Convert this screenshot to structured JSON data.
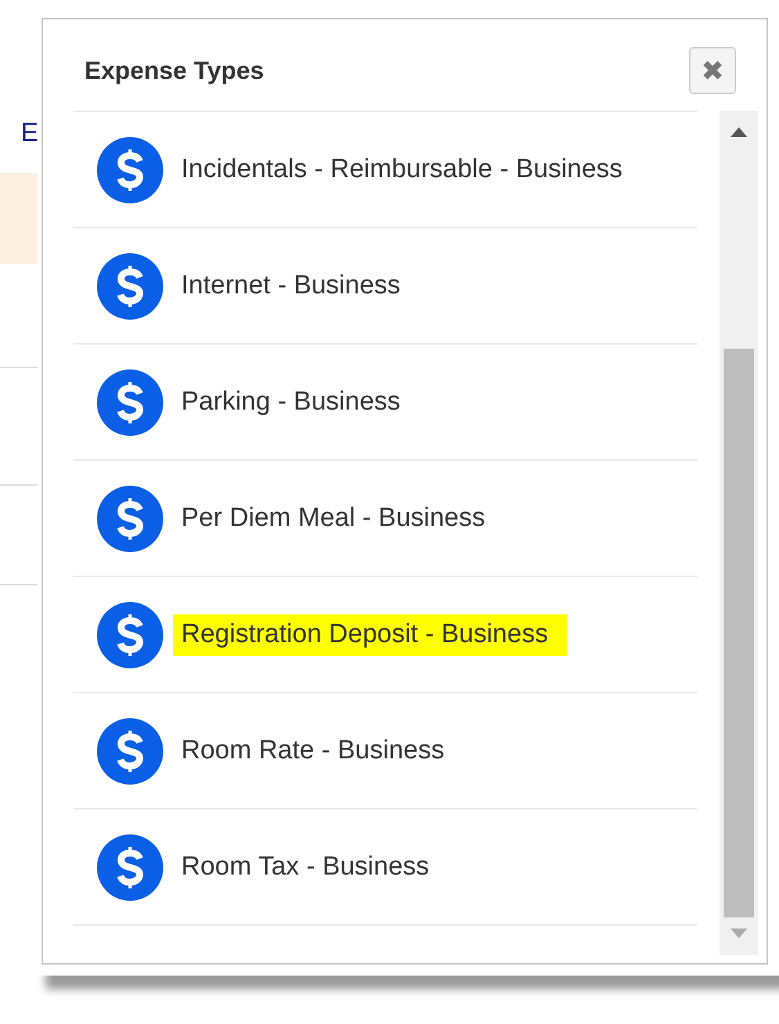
{
  "background": {
    "label": "E"
  },
  "dialog": {
    "title": "Expense Types",
    "close_label": "✖",
    "items": [
      {
        "label": "Incidentals - Reimbursable - Business",
        "highlighted": false
      },
      {
        "label": "Internet - Business",
        "highlighted": false
      },
      {
        "label": "Parking - Business",
        "highlighted": false
      },
      {
        "label": "Per Diem Meal - Business",
        "highlighted": false
      },
      {
        "label": "Registration Deposit - Business",
        "highlighted": true
      },
      {
        "label": "Room Rate - Business",
        "highlighted": false
      },
      {
        "label": "Room Tax - Business",
        "highlighted": false
      }
    ]
  }
}
